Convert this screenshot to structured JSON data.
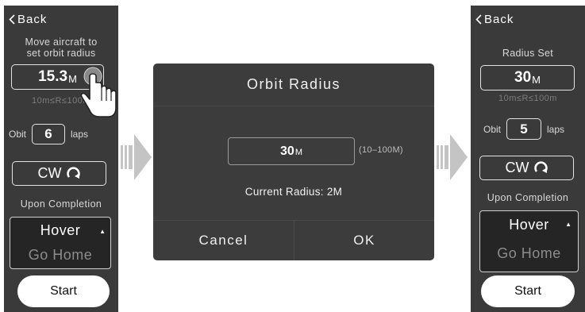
{
  "left_panel": {
    "back_label": "Back",
    "instruction_line1": "Move aircraft to",
    "instruction_line2": "set orbit radius",
    "radius_value": "15.3",
    "radius_unit": "M",
    "range": "10m≤R≤100m",
    "obit_label": "Obit",
    "laps_value": "6",
    "laps_label": "laps",
    "direction_label": "CW",
    "completion_label": "Upon Completion",
    "option_selected": "Hover",
    "option_other": "Go Home",
    "start_label": "Start"
  },
  "dialog": {
    "title": "Orbit Radius",
    "input_value": "30",
    "input_unit": "M",
    "range_hint": "(10–100M)",
    "current_radius": "Current Radius: 2M",
    "cancel_label": "Cancel",
    "ok_label": "OK"
  },
  "right_panel": {
    "back_label": "Back",
    "header": "Radius Set",
    "radius_value": "30",
    "radius_unit": "M",
    "range": "10m≤R≤100m",
    "obit_label": "Obit",
    "laps_value": "5",
    "laps_label": "laps",
    "direction_label": "CW",
    "completion_label": "Upon Completion",
    "option_selected": "Hover",
    "option_other": "Go Home",
    "start_label": "Start"
  },
  "colors": {
    "panel_bg": "#3a3a3a",
    "dialog_bg": "#3c3c3c",
    "arrow_gray": "#c4c4c4",
    "dim_text": "#7c7c7c"
  }
}
